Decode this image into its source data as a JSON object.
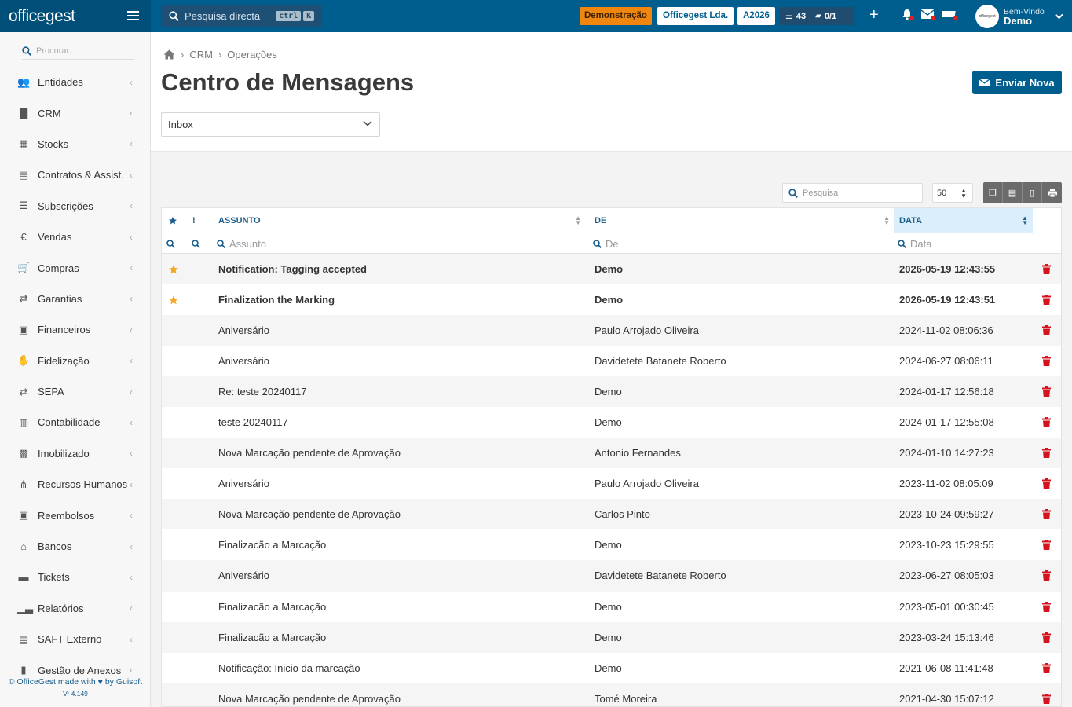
{
  "topbar": {
    "logo_text": "officegest",
    "search_placeholder": "Pesquisa directa",
    "shortcut_key1": "ctrl",
    "shortcut_key2": "K",
    "mode_badge": "Demonstração",
    "company": "Officegest Lda.",
    "year": "A2026",
    "tasks_count": "43",
    "folders_count": "0/1",
    "greeting": "Bem-Vindo",
    "user_name": "Demo",
    "avatar_text": "officegest"
  },
  "sidebar": {
    "search_placeholder": "Procurar...",
    "items": [
      {
        "label": "Entidades",
        "icon": "users-icon"
      },
      {
        "label": "CRM",
        "icon": "book-icon"
      },
      {
        "label": "Stocks",
        "icon": "warehouse-icon"
      },
      {
        "label": "Contratos & Assist.",
        "icon": "contract-icon"
      },
      {
        "label": "Subscrições",
        "icon": "list-icon"
      },
      {
        "label": "Vendas",
        "icon": "euro-icon"
      },
      {
        "label": "Compras",
        "icon": "cart-icon"
      },
      {
        "label": "Garantias",
        "icon": "exchange-icon"
      },
      {
        "label": "Financeiros",
        "icon": "money-icon"
      },
      {
        "label": "Fidelização",
        "icon": "hand-coin-icon"
      },
      {
        "label": "SEPA",
        "icon": "exchange-icon"
      },
      {
        "label": "Contabilidade",
        "icon": "calculator-icon"
      },
      {
        "label": "Imobilizado",
        "icon": "box-icon"
      },
      {
        "label": "Recursos Humanos",
        "icon": "org-chart-icon"
      },
      {
        "label": "Reembolsos",
        "icon": "money-icon"
      },
      {
        "label": "Bancos",
        "icon": "bank-icon"
      },
      {
        "label": "Tickets",
        "icon": "ticket-icon"
      },
      {
        "label": "Relatórios",
        "icon": "chart-icon"
      },
      {
        "label": "SAFT Externo",
        "icon": "file-code-icon"
      },
      {
        "label": "Gestão de Anexos",
        "icon": "attachment-icon"
      }
    ],
    "footer_pre": "© OfficeGest made with",
    "footer_post": "by Guisoft",
    "version": "Vr 4.149"
  },
  "breadcrumb": [
    "CRM",
    "Operações"
  ],
  "page": {
    "title": "Centro de Mensagens",
    "send_button": "Enviar Nova",
    "folder": "Inbox"
  },
  "toolbar": {
    "search_placeholder": "Pesquisa",
    "page_size": "50"
  },
  "table": {
    "headers": {
      "priority": "!",
      "subject": "ASSUNTO",
      "from": "DE",
      "date": "DATA"
    },
    "filters": {
      "subject": "Assunto",
      "from": "De",
      "date": "Data"
    },
    "rows": [
      {
        "starred": true,
        "bold": true,
        "subject": "Notification: Tagging accepted",
        "from": "Demo",
        "date": "2026-05-19 12:43:55"
      },
      {
        "starred": true,
        "bold": true,
        "subject": "Finalization the Marking",
        "from": "Demo",
        "date": "2026-05-19 12:43:51"
      },
      {
        "starred": false,
        "bold": false,
        "subject": "Aniversário",
        "from": "Paulo Arrojado Oliveira",
        "date": "2024-11-02 08:06:36"
      },
      {
        "starred": false,
        "bold": false,
        "subject": "Aniversário",
        "from": "Davidetete Batanete Roberto",
        "date": "2024-06-27 08:06:11"
      },
      {
        "starred": false,
        "bold": false,
        "subject": "Re: teste 20240117",
        "from": "Demo",
        "date": "2024-01-17 12:56:18"
      },
      {
        "starred": false,
        "bold": false,
        "subject": "teste 20240117",
        "from": "Demo",
        "date": "2024-01-17 12:55:08"
      },
      {
        "starred": false,
        "bold": false,
        "subject": "Nova Marcação pendente de Aprovação",
        "from": "Antonio Fernandes",
        "date": "2024-01-10 14:27:23"
      },
      {
        "starred": false,
        "bold": false,
        "subject": "Aniversário",
        "from": "Paulo Arrojado Oliveira",
        "date": "2023-11-02 08:05:09"
      },
      {
        "starred": false,
        "bold": false,
        "subject": "Nova Marcação pendente de Aprovação",
        "from": "Carlos Pinto",
        "date": "2023-10-24 09:59:27"
      },
      {
        "starred": false,
        "bold": false,
        "subject": "Finalizacão a Marcação",
        "from": "Demo",
        "date": "2023-10-23 15:29:55"
      },
      {
        "starred": false,
        "bold": false,
        "subject": "Aniversário",
        "from": "Davidetete Batanete Roberto",
        "date": "2023-06-27 08:05:03"
      },
      {
        "starred": false,
        "bold": false,
        "subject": "Finalizacão a Marcação",
        "from": "Demo",
        "date": "2023-05-01 00:30:45"
      },
      {
        "starred": false,
        "bold": false,
        "subject": "Finalizacão a Marcação",
        "from": "Demo",
        "date": "2023-03-24 15:13:46"
      },
      {
        "starred": false,
        "bold": false,
        "subject": "Notificação: Inicio da marcação",
        "from": "Demo",
        "date": "2021-06-08 11:41:48"
      },
      {
        "starred": false,
        "bold": false,
        "subject": "Nova Marcação pendente de Aprovação",
        "from": "Tomé Moreira",
        "date": "2021-04-30 15:07:12"
      }
    ]
  },
  "colors": {
    "primary": "#005e8f",
    "logo_bg": "#004f79",
    "demo_badge": "#f0860f",
    "star": "#f5a623",
    "delete": "#d4131e"
  }
}
